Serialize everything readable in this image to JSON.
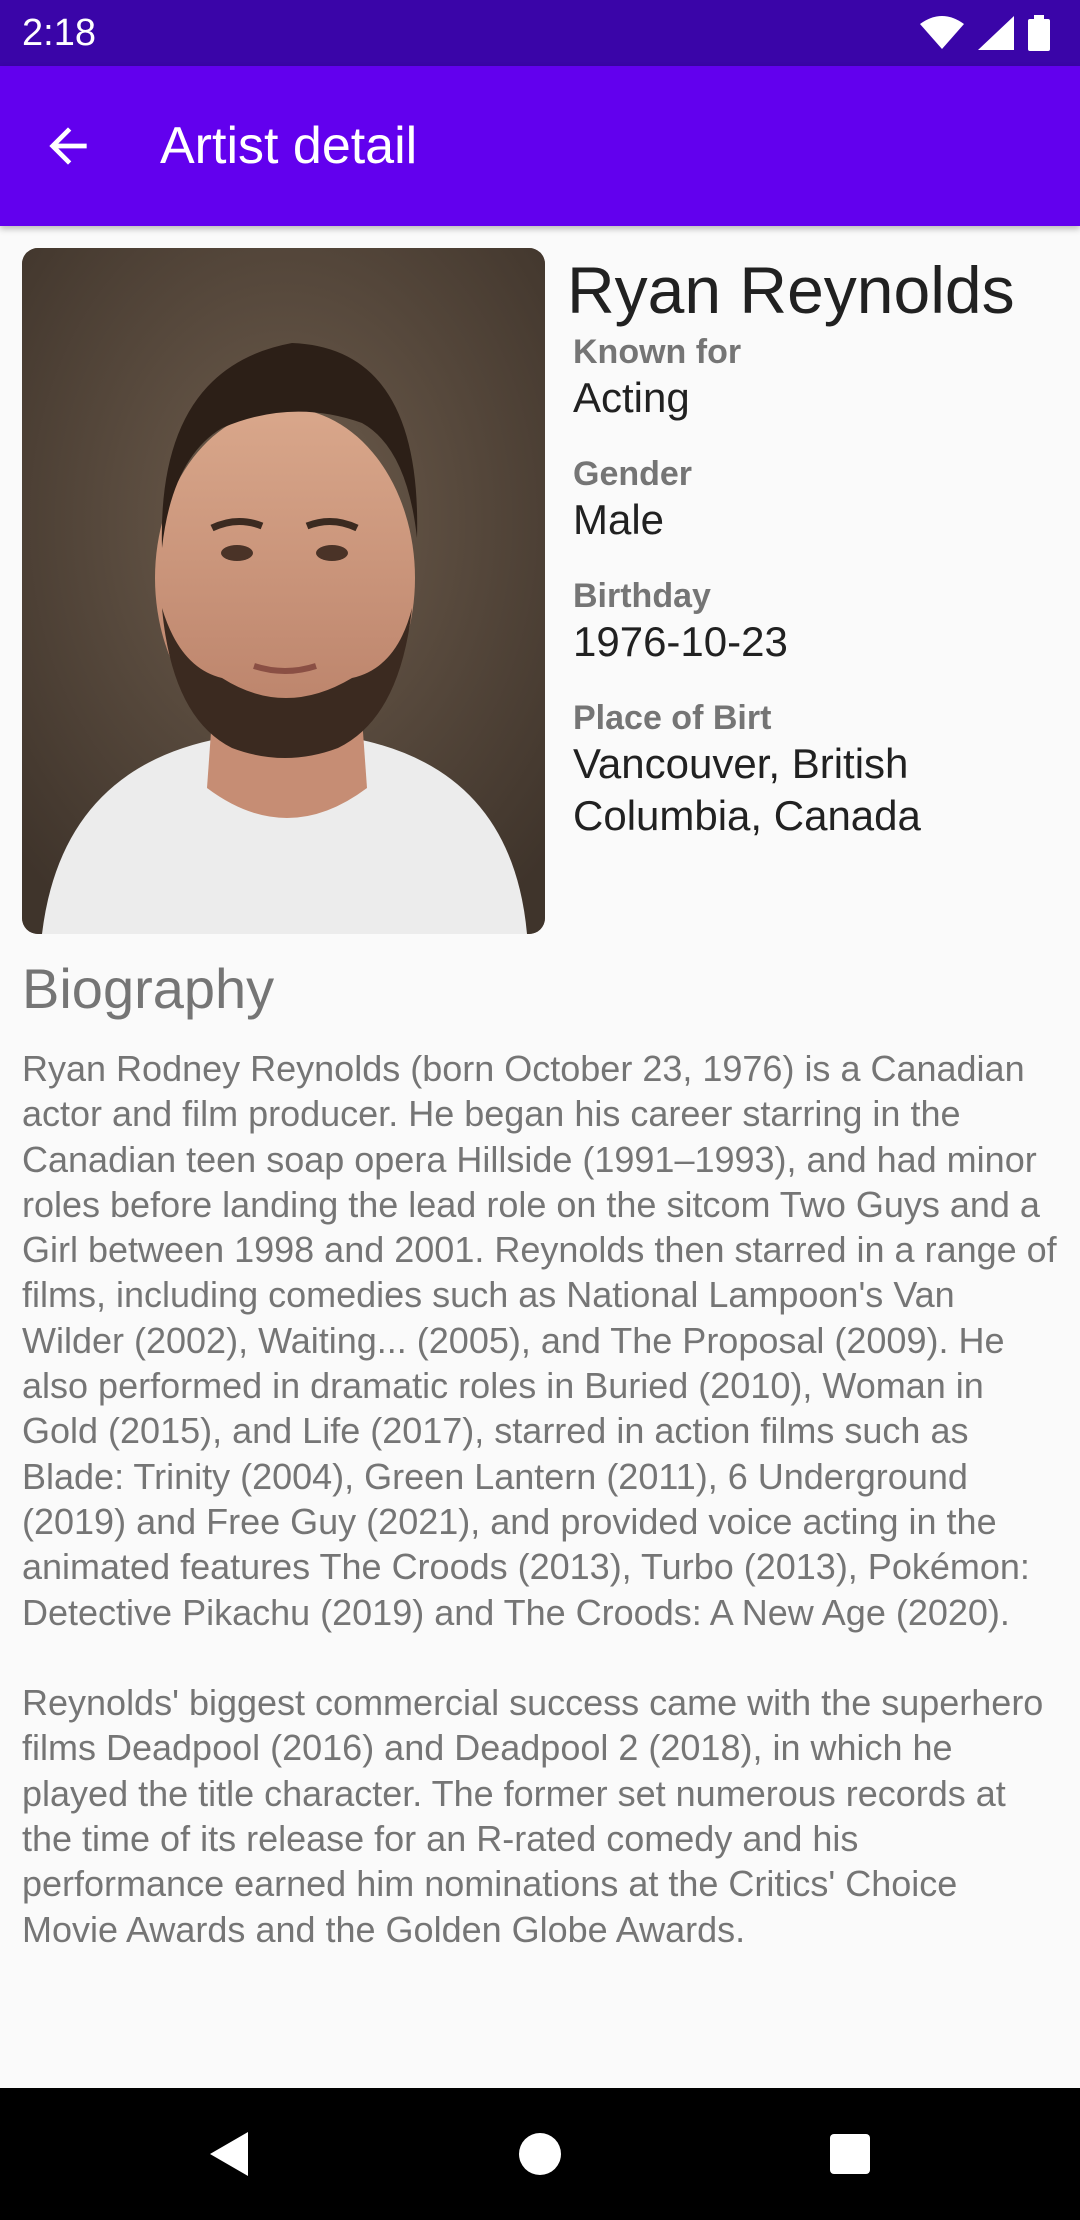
{
  "status_bar": {
    "time": "2:18",
    "icons": [
      "wifi-icon",
      "signal-icon",
      "battery-icon"
    ]
  },
  "app_bar": {
    "title": "Artist detail",
    "back_icon": "arrow-back-icon"
  },
  "artist": {
    "name": "Ryan Reynolds",
    "known_for_label": "Known for",
    "known_for": "Acting",
    "gender_label": "Gender",
    "gender": "Male",
    "birthday_label": "Birthday",
    "birthday": "1976-10-23",
    "place_label": "Place of Birt",
    "place": "Vancouver, British Columbia, Canada"
  },
  "biography": {
    "heading": "Biography",
    "text": "Ryan Rodney Reynolds (born October 23, 1976) is a Canadian actor and film producer. He began his career starring in the Canadian teen soap opera Hillside (1991–1993), and had minor roles before landing the lead role on the sitcom Two Guys and a Girl between 1998 and 2001. Reynolds then starred in a range of films, including comedies such as National Lampoon's Van Wilder (2002), Waiting... (2005), and The Proposal (2009). He also performed in dramatic roles in Buried (2010), Woman in Gold (2015), and Life (2017), starred in action films such as Blade: Trinity (2004), Green Lantern (2011), 6 Underground (2019) and Free Guy (2021), and provided voice acting in the animated features The Croods (2013), Turbo (2013), Pokémon: Detective Pikachu (2019) and The Croods: A New Age (2020).\n\nReynolds' biggest commercial success came with the superhero films Deadpool (2016) and Deadpool 2 (2018), in which he played the title character. The former set numerous records at the time of its release for an R-rated comedy and his performance earned him nominations at the Critics' Choice Movie Awards and the Golden Globe Awards."
  },
  "colors": {
    "status_bar": "#3a05a8",
    "app_bar": "#6200ee",
    "background": "#fafafa",
    "nav_bar": "#000000"
  },
  "nav_bar": {
    "icons": [
      "back-triangle-icon",
      "home-circle-icon",
      "recents-square-icon"
    ]
  }
}
